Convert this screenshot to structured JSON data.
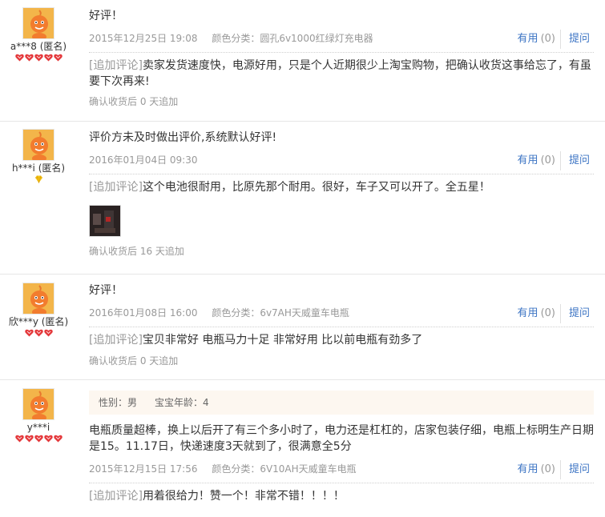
{
  "reviews": [
    {
      "username": "a***8 (匿名)",
      "text": "好评！",
      "date": "2015年12月25日 19:08",
      "sku": "颜色分类：圆孔6v1000红绿灯充电器",
      "useful_label": "有用",
      "useful_count": "(0)",
      "ask_label": "提问",
      "append_tag": "[追加评论]",
      "append_text": "卖家发货速度快，电源好用，只是个人近期很少上淘宝购物，把确认收货这事给忘了，有虽要下次再来!",
      "confirm": "确认收货后 0 天追加",
      "rank": {
        "type": "hearts",
        "count": 5
      }
    },
    {
      "username": "h***i (匿名)",
      "text": "评价方未及时做出评价,系统默认好评!",
      "date": "2016年01月04日 09:30",
      "sku": "",
      "useful_label": "有用",
      "useful_count": "(0)",
      "ask_label": "提问",
      "append_tag": "[追加评论]",
      "append_text": "这个电池很耐用，比原先那个耐用。很好，车子又可以开了。全五星！",
      "confirm": "确认收货后 16 天追加",
      "rank": {
        "type": "diamond",
        "count": 1
      }
    },
    {
      "username": "欣***y (匿名)",
      "text": "好评！",
      "date": "2016年01月08日 16:00",
      "sku": "颜色分类：6v7AH天威童车电瓶",
      "useful_label": "有用",
      "useful_count": "(0)",
      "ask_label": "提问",
      "append_tag": "[追加评论]",
      "append_text": "宝贝非常好 电瓶马力十足 非常好用 比以前电瓶有劲多了",
      "confirm": "确认收货后 0 天追加",
      "rank": {
        "type": "hearts",
        "count": 3
      }
    },
    {
      "username": "y***i",
      "profile_gender": "性别：男",
      "profile_baby": "宝宝年龄：4",
      "text": "电瓶质量超棒，换上以后开了有三个多小时了，电力还是杠杠的，店家包装仔细，电瓶上标明生产日期是15。11.17日，快递速度3天就到了，很满意全5分",
      "date": "2015年12月15日 17:56",
      "sku": "颜色分类：6V10AH天威童车电瓶",
      "useful_label": "有用",
      "useful_count": "(0)",
      "ask_label": "提问",
      "append_tag": "[追加评论]",
      "append_text": "用着很给力！赞一个！非常不错！！！！",
      "rank": {
        "type": "hearts",
        "count": 5
      }
    }
  ],
  "colors": {
    "link": "#3c74c4",
    "meta": "#999999",
    "heart": "#e4393c",
    "diamond": "#f5c518",
    "profile_bg": "#fdf7f0"
  }
}
